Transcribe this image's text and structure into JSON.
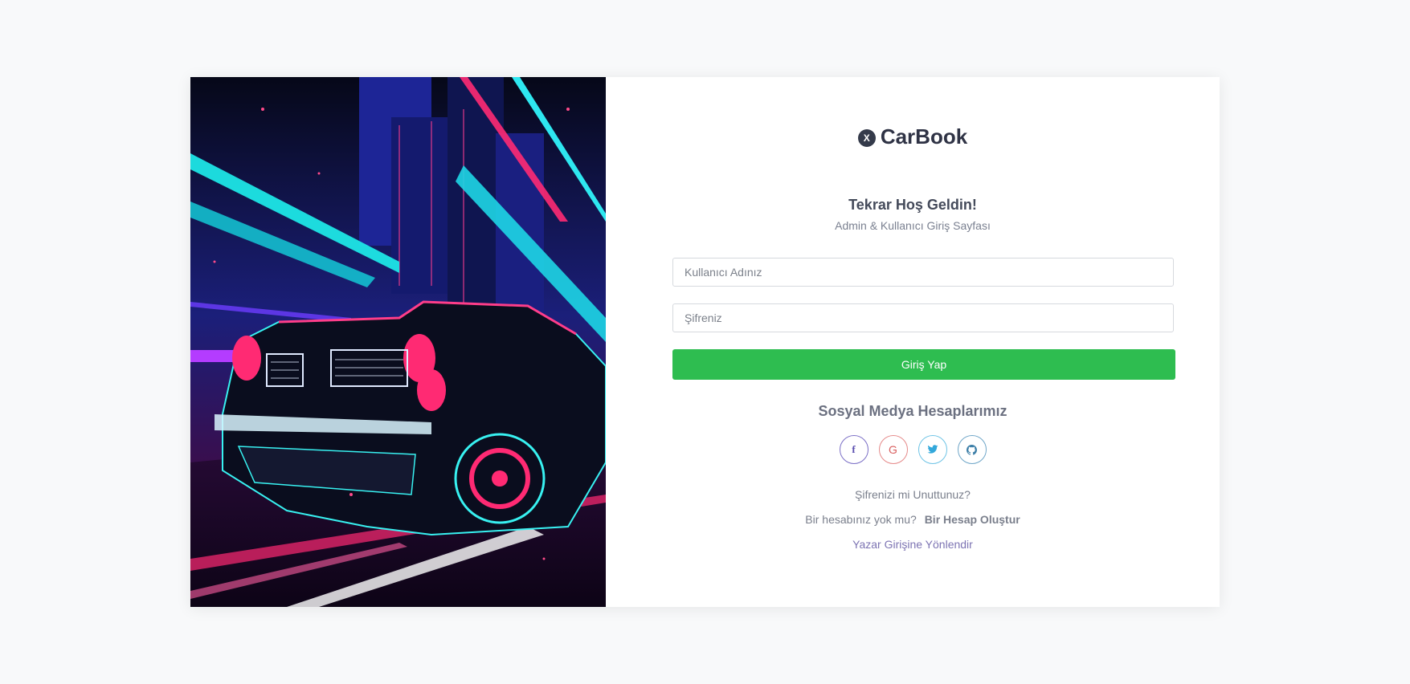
{
  "brand": {
    "name": "CarBook",
    "logo_mark": "X",
    "icon": "carbook-logo-icon"
  },
  "login": {
    "greeting": "Tekrar Hoş Geldin!",
    "subtitle": "Admin & Kullanıcı Giriş Sayfası",
    "username_placeholder": "Kullanıcı Adınız",
    "username_value": "",
    "password_placeholder": "Şifreniz",
    "password_value": "",
    "submit_label": "Giriş Yap"
  },
  "social": {
    "title": "Sosyal Medya Hesaplarımız",
    "items": [
      {
        "icon": "facebook-icon",
        "glyph": "f"
      },
      {
        "icon": "google-icon",
        "glyph": "G"
      },
      {
        "icon": "twitter-icon",
        "glyph": "t"
      },
      {
        "icon": "github-icon",
        "glyph": "gh"
      }
    ]
  },
  "links": {
    "forgot_password": "Şifrenizi mi Unuttunuz?",
    "no_account_text": "Bir hesabınız yok mu?",
    "create_account": "Bir Hesap Oluştur",
    "writer_login": "Yazar Girişine Yönlendir"
  },
  "colors": {
    "primary_button": "#2ebd50",
    "page_background": "#f8f9fa",
    "facebook": "#5b4fb0",
    "google": "#d85c5c",
    "twitter": "#33a8db",
    "github": "#3d7fa8",
    "writer_link": "#7d74b3"
  }
}
